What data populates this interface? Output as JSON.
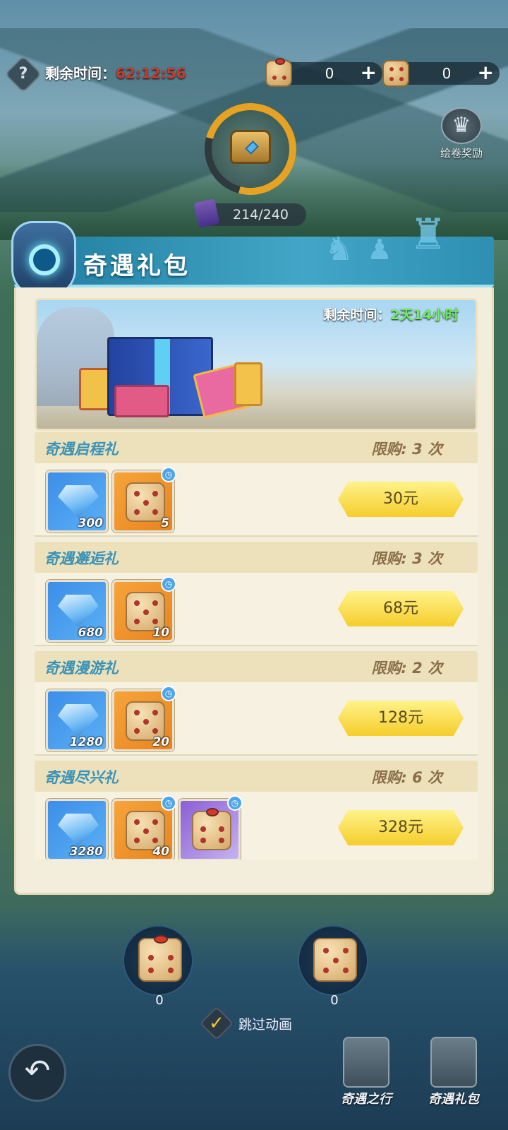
{
  "topbar": {
    "help_icon": "?",
    "timer_label": "剩余时间：",
    "timer_value": "62:12:56",
    "resource1": "0",
    "resource2": "0",
    "plus": "+"
  },
  "chest": {
    "progress": "214/240",
    "progress_fraction": 0.8917
  },
  "reward": {
    "label": "绘卷奖励"
  },
  "panel": {
    "title": "奇遇礼包",
    "banner_timer_label": "剩余时间：",
    "banner_timer_value": "2天14小时"
  },
  "packs": [
    {
      "name": "奇遇启程礼",
      "limit": "限购: 3 次",
      "items": [
        {
          "type": "diamond",
          "count": "300"
        },
        {
          "type": "dice",
          "count": "5"
        }
      ],
      "price": "30元"
    },
    {
      "name": "奇遇邂逅礼",
      "limit": "限购: 3 次",
      "items": [
        {
          "type": "diamond",
          "count": "680"
        },
        {
          "type": "dice",
          "count": "10"
        }
      ],
      "price": "68元"
    },
    {
      "name": "奇遇漫游礼",
      "limit": "限购: 2 次",
      "items": [
        {
          "type": "diamond",
          "count": "1280"
        },
        {
          "type": "dice",
          "count": "20"
        }
      ],
      "price": "128元"
    },
    {
      "name": "奇遇尽兴礼",
      "limit": "限购: 6 次",
      "items": [
        {
          "type": "diamond",
          "count": "3280"
        },
        {
          "type": "dice",
          "count": "40"
        },
        {
          "type": "magic-dice",
          "count": ""
        }
      ],
      "price": "328元"
    }
  ],
  "bottom": {
    "magic_dice_count": "0",
    "dice_count": "0",
    "skip_label": "跳过动画",
    "nav": [
      "奇遇之行",
      "奇遇礼包"
    ]
  }
}
